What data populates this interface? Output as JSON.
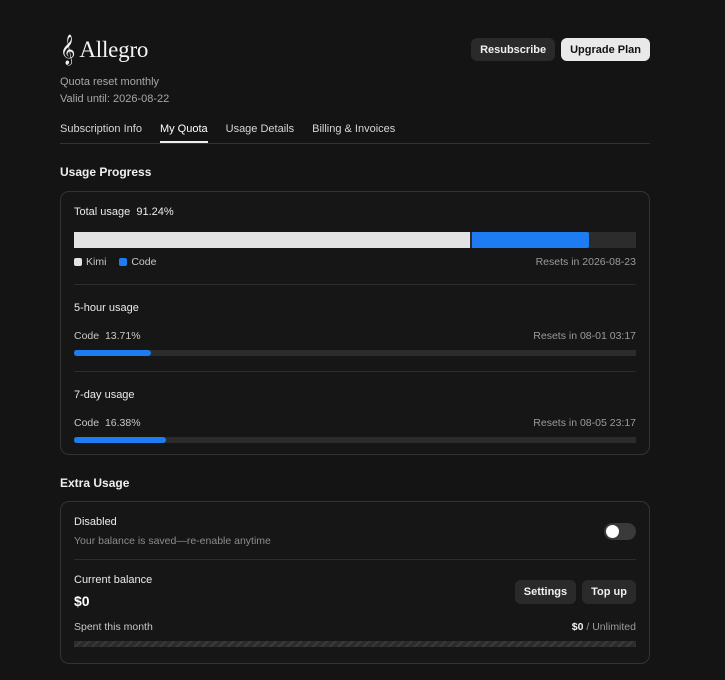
{
  "brand": {
    "name": "Allegro",
    "icon": "treble-clef-icon"
  },
  "header": {
    "quota_reset": "Quota reset monthly",
    "valid_until": "Valid until: 2026-08-22",
    "resubscribe": "Resubscribe",
    "upgrade": "Upgrade Plan"
  },
  "tabs": [
    {
      "label": "Subscription Info",
      "active": false
    },
    {
      "label": "My Quota",
      "active": true
    },
    {
      "label": "Usage Details",
      "active": false
    },
    {
      "label": "Billing & Invoices",
      "active": false
    }
  ],
  "usage": {
    "title": "Usage Progress",
    "total_label": "Total usage",
    "total_value": "91.24%",
    "total_kimi": 0.705,
    "total_code": 0.2075,
    "legend_kimi": "Kimi",
    "legend_code": "Code",
    "kimi_color": "#e3e3e3",
    "code_color": "#1e7cf2",
    "total_reset": "Resets in 2026-08-23",
    "five_hour": {
      "title": "5-hour usage",
      "label": "Code",
      "value": "13.71%",
      "fraction": 0.1371,
      "reset": "Resets in 08-01 03:17"
    },
    "seven_day": {
      "title": "7-day usage",
      "label": "Code",
      "value": "16.38%",
      "fraction": 0.1638,
      "reset": "Resets in 08-05 23:17"
    }
  },
  "extra": {
    "title": "Extra Usage",
    "status": "Disabled",
    "note": "Your balance is saved—re-enable anytime",
    "balance_label": "Current balance",
    "balance_value": "$0",
    "settings": "Settings",
    "topup": "Top up",
    "spent_label": "Spent this month",
    "spent_value": "$0",
    "spent_limit": "/ Unlimited"
  }
}
